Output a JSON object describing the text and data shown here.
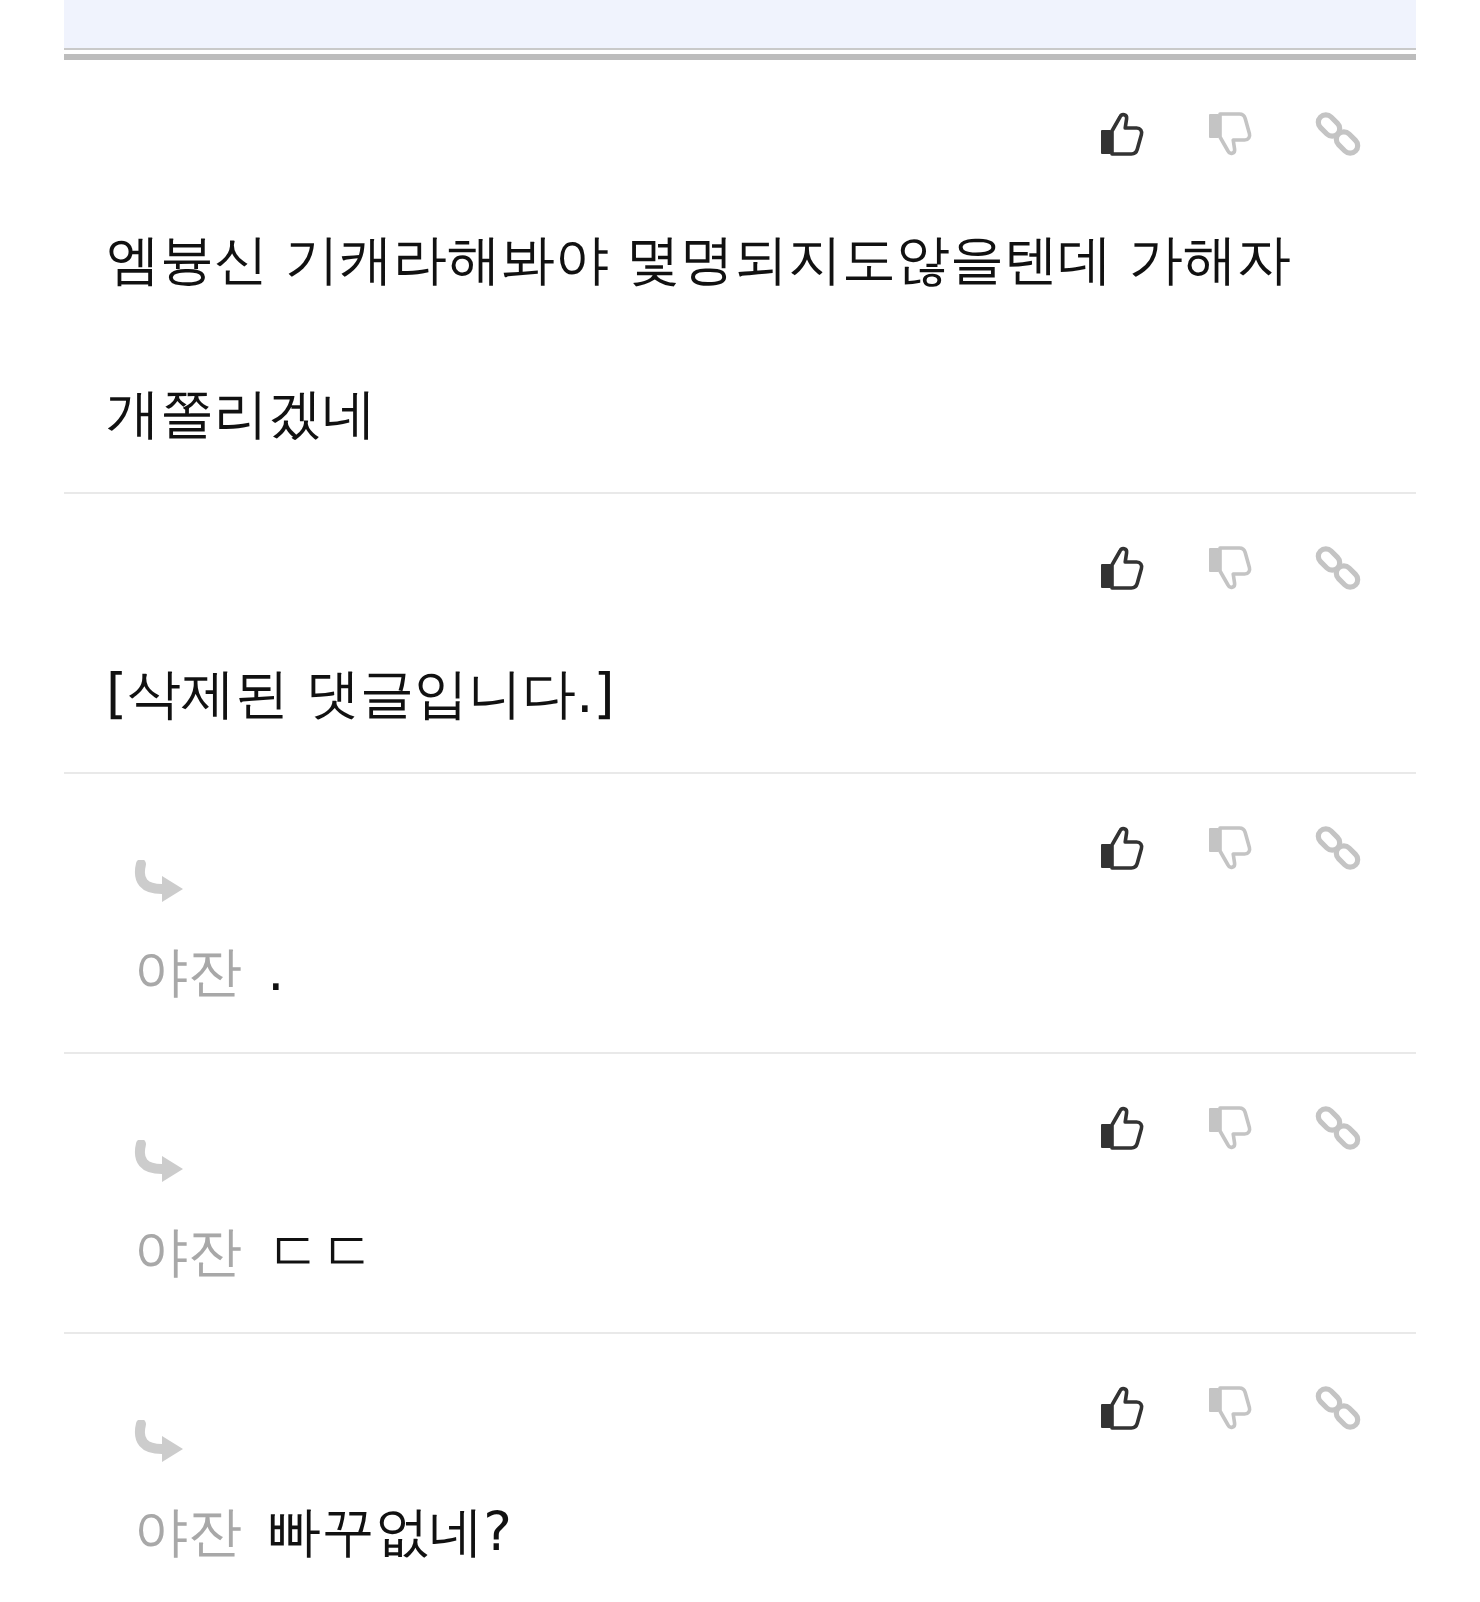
{
  "comments": [
    {
      "kind": "comment",
      "text": "엠븅신 기캐라해봐야 몇명되지도않을텐데 가해자 개쫄리겠네"
    },
    {
      "kind": "comment",
      "text": "[삭제된 댓글입니다.]"
    },
    {
      "kind": "reply",
      "author": "야잔",
      "text": "."
    },
    {
      "kind": "reply",
      "author": "야잔",
      "text": "ㄷㄷ"
    },
    {
      "kind": "reply",
      "author": "야잔",
      "text": "빠꾸없네?"
    }
  ]
}
